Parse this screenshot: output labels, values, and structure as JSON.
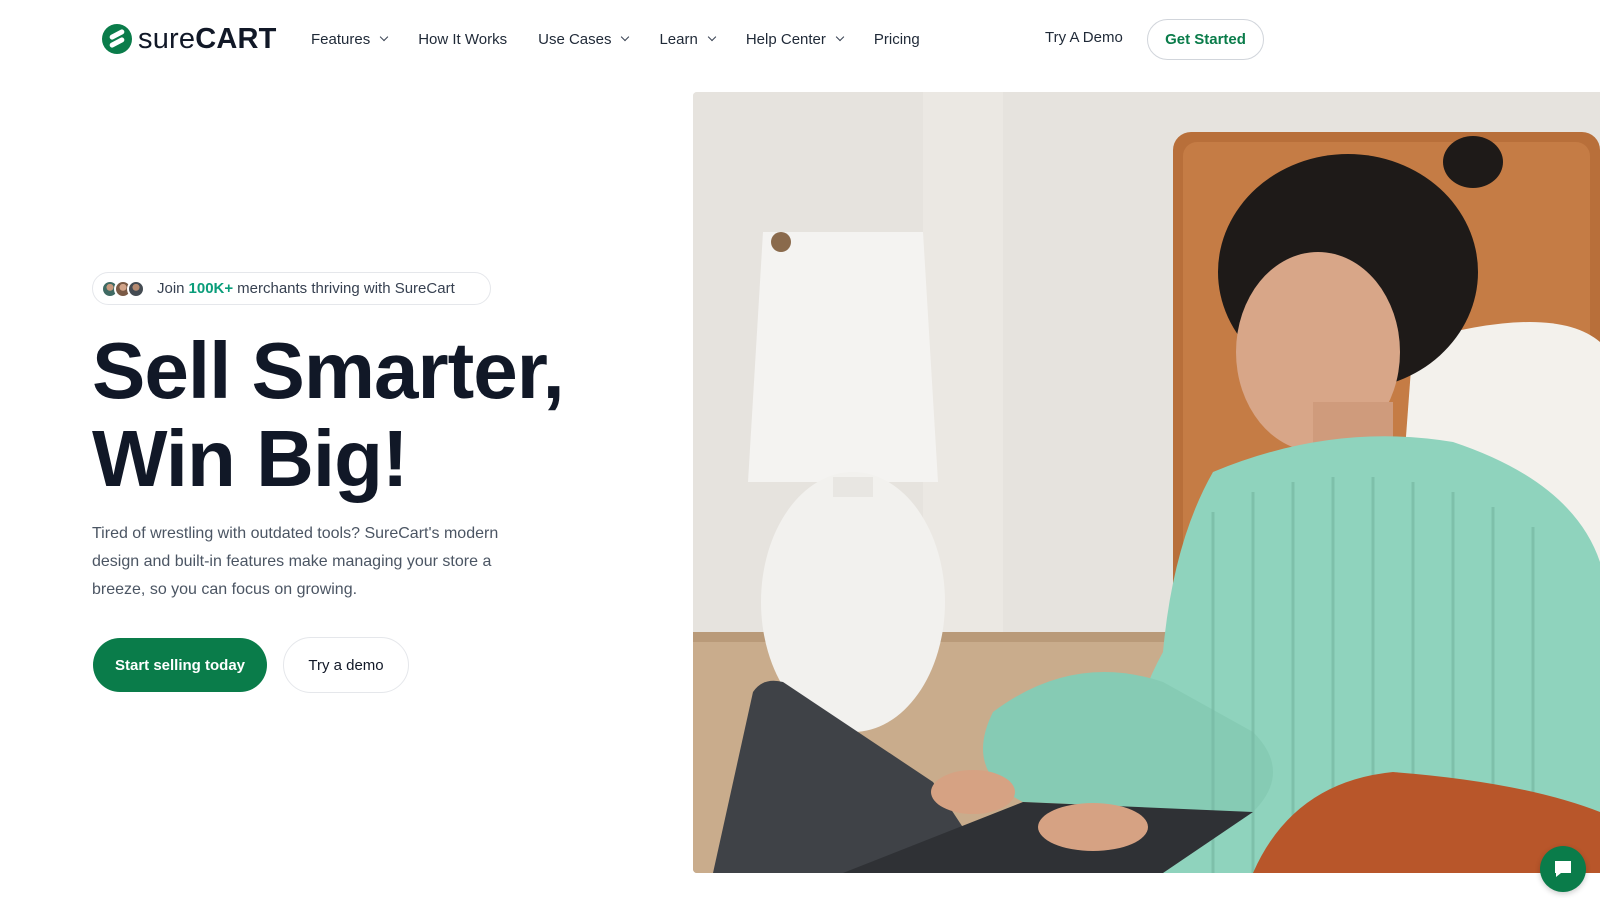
{
  "brand": {
    "name_light": "sure",
    "name_bold": "CART",
    "color": "#0a7c4a",
    "accent": "#0a9d7a"
  },
  "nav": {
    "items": [
      {
        "label": "Features",
        "has_dropdown": true
      },
      {
        "label": "How It Works",
        "has_dropdown": false
      },
      {
        "label": "Use Cases",
        "has_dropdown": true
      },
      {
        "label": "Learn",
        "has_dropdown": true
      },
      {
        "label": "Help Center",
        "has_dropdown": true
      },
      {
        "label": "Pricing",
        "has_dropdown": false
      }
    ],
    "try_demo_label": "Try A Demo",
    "get_started_label": "Get Started"
  },
  "hero": {
    "social_proof": {
      "prefix": "Join",
      "highlight": "100K+",
      "suffix": "merchants thriving with SureCart"
    },
    "headline_line1": "Sell Smarter,",
    "headline_line2": "Win Big!",
    "subtext": "Tired of wrestling with outdated tools? SureCart's modern design and built-in features make managing your store a breeze, so you can focus on growing.",
    "primary_cta": "Start selling today",
    "secondary_cta": "Try a demo"
  },
  "icons": {
    "logo": "surecart-logo-icon",
    "chevron": "chevron-down-icon",
    "chat": "chat-bubble-icon"
  }
}
